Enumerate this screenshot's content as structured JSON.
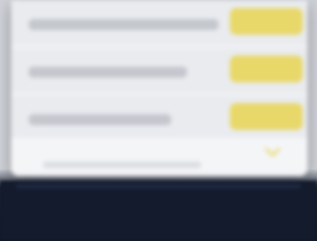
{
  "list": {
    "rows": [
      {
        "label": "",
        "action_label": ""
      },
      {
        "label": "",
        "action_label": ""
      },
      {
        "label": "",
        "action_label": ""
      }
    ]
  },
  "colors": {
    "panel": "#eceef2",
    "accent": "#e8d86a",
    "backdrop": "#121a2a"
  },
  "icons": {
    "footer": "chevron-down-icon"
  }
}
